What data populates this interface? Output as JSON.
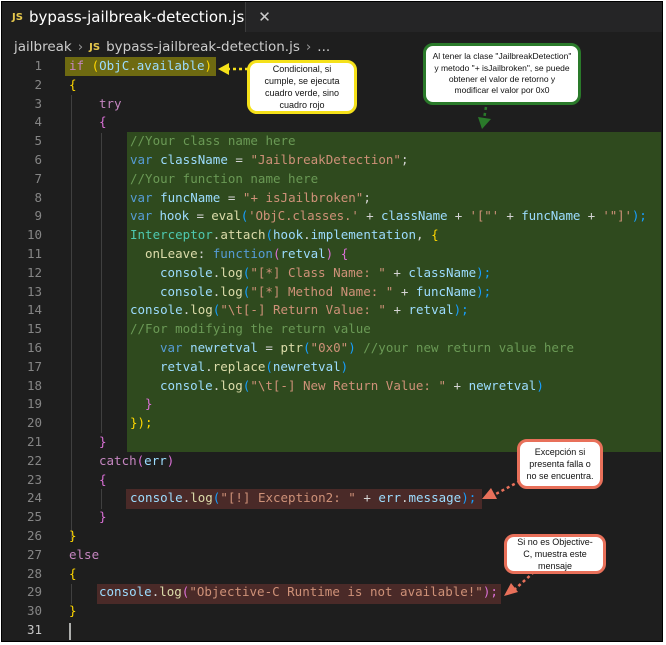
{
  "tab": {
    "badge": "JS",
    "title": "bypass-jailbreak-detection.js",
    "close": "✕"
  },
  "breadcrumb": {
    "folder": "jailbreak",
    "sep": "›",
    "badge": "JS",
    "file": "bypass-jailbreak-detection.js",
    "sep2": "›",
    "more": "..."
  },
  "line_numbers": [
    "1",
    "2",
    "3",
    "4",
    "5",
    "6",
    "7",
    "8",
    "9",
    "10",
    "11",
    "12",
    "13",
    "14",
    "15",
    "16",
    "17",
    "18",
    "19",
    "20",
    "21",
    "22",
    "23",
    "24",
    "25",
    "26",
    "27",
    "28",
    "29",
    "30",
    "31"
  ],
  "code": {
    "l1": [
      "if",
      "(",
      "ObjC",
      ".",
      "available",
      ")"
    ],
    "l2": [
      "{"
    ],
    "l3": [
      "try"
    ],
    "l4": [
      "{"
    ],
    "l5": [
      "//Your class name here"
    ],
    "l6": [
      "var",
      "className",
      "=",
      "\"JailbreakDetection\"",
      ";"
    ],
    "l7": [
      "//Your function name here"
    ],
    "l8": [
      "var",
      "funcName",
      "=",
      "\"+ isJailbroken\"",
      ";"
    ],
    "l9": [
      "var",
      "hook",
      "=",
      "eval",
      "(",
      "'ObjC.classes.'",
      "+",
      "className",
      "+",
      "'[\"'",
      "+",
      "funcName",
      "+",
      "'\"]'",
      ");"
    ],
    "l10": [
      "Interceptor",
      ".",
      "attach",
      "(",
      "hook",
      ".",
      "implementation",
      ",",
      "{"
    ],
    "l11": [
      "onLeave",
      ":",
      "function",
      "(",
      "retval",
      ")",
      "{"
    ],
    "l12": [
      "console",
      ".",
      "log",
      "(",
      "\"[*] Class Name: \"",
      "+",
      "className",
      ");"
    ],
    "l13": [
      "console",
      ".",
      "log",
      "(",
      "\"[*] Method Name: \"",
      "+",
      "funcName",
      ");"
    ],
    "l14": [
      "console",
      ".",
      "log",
      "(",
      "\"\\t[-] Return Value: \"",
      "+",
      "retval",
      ");"
    ],
    "l15": [
      "//For modifying the return value"
    ],
    "l16": [
      "var",
      "newretval",
      "=",
      "ptr",
      "(",
      "\"0x0\"",
      ")",
      "//your new return value here"
    ],
    "l17": [
      "retval",
      ".",
      "replace",
      "(",
      "newretval",
      ")"
    ],
    "l18": [
      "console",
      ".",
      "log",
      "(",
      "\"\\t[-] New Return Value: \"",
      "+",
      "newretval",
      ")"
    ],
    "l19": [
      "}"
    ],
    "l20": [
      "});"
    ],
    "l21": [
      "}"
    ],
    "l22": [
      "catch",
      "(",
      "err",
      ")"
    ],
    "l23": [
      "{"
    ],
    "l24": [
      "console",
      ".",
      "log",
      "(",
      "\"[!] Exception2: \"",
      "+",
      "err",
      ".",
      "message",
      ");"
    ],
    "l25": [
      "}"
    ],
    "l26": [
      "}"
    ],
    "l27": [
      "else"
    ],
    "l28": [
      "{"
    ],
    "l29": [
      "console",
      ".",
      "log",
      "(",
      "\"Objective-C Runtime is not available!\"",
      ");"
    ],
    "l30": [
      "}"
    ]
  },
  "annotations": {
    "yellow": "Condicional, si cumple, se ejecuta cuadro verde, sino cuadro rojo",
    "green": "Al tener la clase \"JailbreakDetection\" y metodo \"+ isJailbroken\", se puede obtener el valor de retorno y modificar el valor por 0x0",
    "red_exception": "Excepción si presenta falla o no se encuentra.",
    "red_objc": "Si no es Objective-C, muestra este mensaje"
  },
  "colors": {
    "highlight_yellow": "#6e6a11",
    "highlight_green": "#2f4a1e",
    "highlight_red": "#4a2a28",
    "note_yellow_border": "#f5e11a",
    "note_green_border": "#2a7a2a",
    "note_red_border": "#e8705a"
  }
}
